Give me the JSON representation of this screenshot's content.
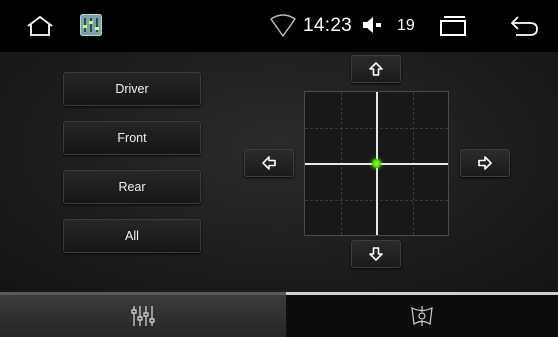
{
  "status_bar": {
    "time": "14:23",
    "volume_level": "19",
    "icons": [
      "home-icon",
      "equalizer-app-icon",
      "wifi-icon",
      "volume-icon",
      "recent-apps-icon",
      "back-icon"
    ]
  },
  "zones": [
    {
      "label": "Driver"
    },
    {
      "label": "Front"
    },
    {
      "label": "Rear"
    },
    {
      "label": "All"
    }
  ],
  "balance_pad": {
    "x": 0,
    "y": 0,
    "point_color": "#6cff20"
  },
  "tabs": [
    {
      "name": "equalizer",
      "icon": "equalizer-icon",
      "selected": true
    },
    {
      "name": "balance",
      "icon": "balance-icon",
      "selected": false
    }
  ],
  "colors": {
    "background": "#000000",
    "panel": "#1c1c1c",
    "accent": "#6cff20"
  }
}
